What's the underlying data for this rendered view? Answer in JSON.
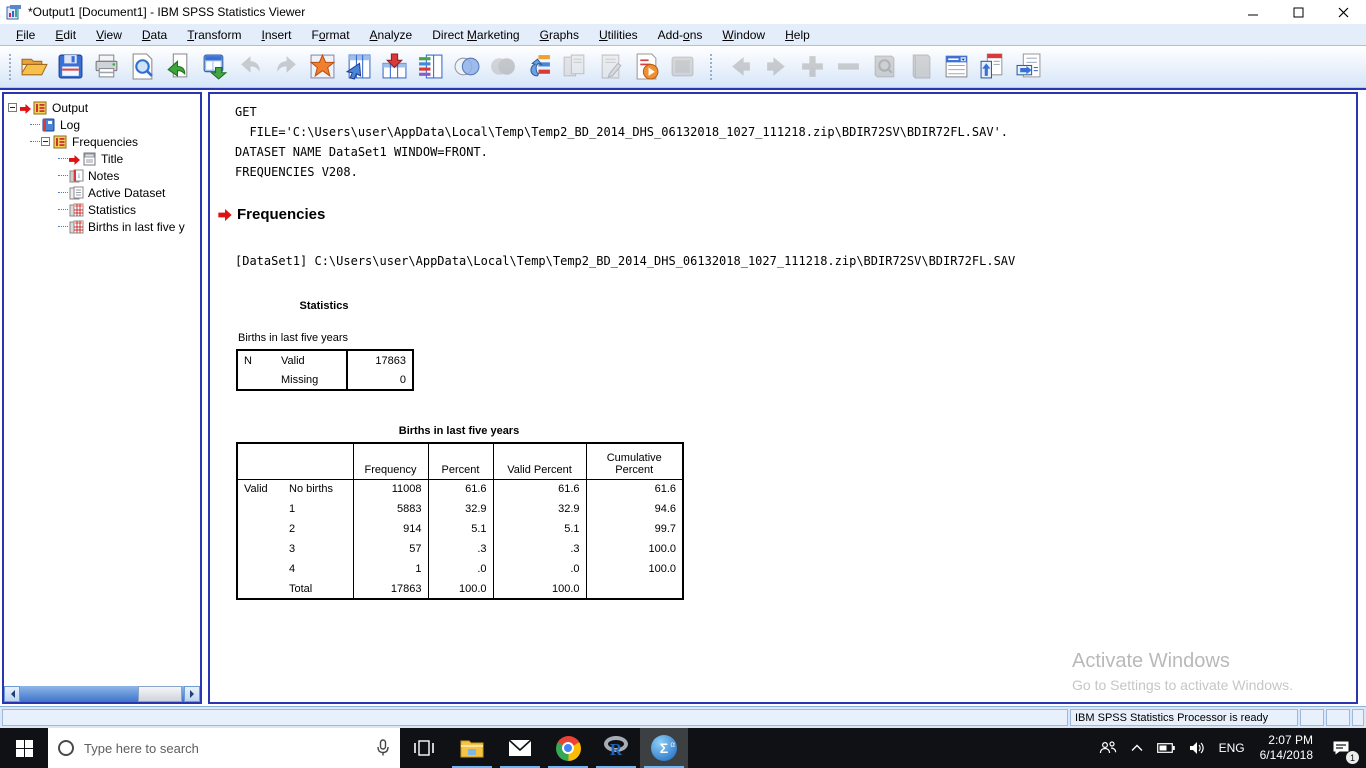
{
  "window": {
    "title": "*Output1 [Document1] - IBM SPSS Statistics Viewer"
  },
  "menu": {
    "items": [
      {
        "label": "File",
        "u": 0
      },
      {
        "label": "Edit",
        "u": 0
      },
      {
        "label": "View",
        "u": 0
      },
      {
        "label": "Data",
        "u": 0
      },
      {
        "label": "Transform",
        "u": 0
      },
      {
        "label": "Insert",
        "u": 0
      },
      {
        "label": "Format",
        "u": 1
      },
      {
        "label": "Analyze",
        "u": 0
      },
      {
        "label": "Direct Marketing",
        "u": 7
      },
      {
        "label": "Graphs",
        "u": 0
      },
      {
        "label": "Utilities",
        "u": 0
      },
      {
        "label": "Add-ons",
        "u": 4
      },
      {
        "label": "Window",
        "u": 0
      },
      {
        "label": "Help",
        "u": 0
      }
    ]
  },
  "toolbar": {
    "items": [
      {
        "name": "open-data-document",
        "glyph": "folder"
      },
      {
        "name": "save-document",
        "glyph": "floppy"
      },
      {
        "name": "print",
        "glyph": "printer"
      },
      {
        "name": "print-preview",
        "glyph": "doc-mag"
      },
      {
        "name": "recall-dialogs",
        "glyph": "doc-recall"
      },
      {
        "name": "export-output",
        "glyph": "export"
      },
      {
        "name": "undo",
        "glyph": "undo",
        "disabled": true
      },
      {
        "name": "redo",
        "glyph": "redo",
        "disabled": true
      },
      {
        "name": "goto-chart",
        "glyph": "star-grid"
      },
      {
        "name": "goto-data",
        "glyph": "grid-go"
      },
      {
        "name": "goto-case",
        "glyph": "grid-case"
      },
      {
        "name": "variables",
        "glyph": "grid-vars"
      },
      {
        "name": "use-variable-sets",
        "glyph": "venn"
      },
      {
        "name": "show-all-variables",
        "glyph": "venn-gray",
        "disabled": true
      },
      {
        "name": "select-last-output",
        "glyph": "tree-select"
      },
      {
        "name": "designate-window",
        "glyph": "docs-gray",
        "disabled": true
      },
      {
        "name": "edit-output",
        "glyph": "doc-edit",
        "disabled": true
      },
      {
        "name": "run-script",
        "glyph": "doc-play"
      },
      {
        "name": "activate-item",
        "glyph": "frame-gray",
        "disabled": true
      },
      {
        "sep": true
      },
      {
        "name": "promote-outline",
        "glyph": "arrow-left",
        "disabled": true
      },
      {
        "name": "demote-outline",
        "glyph": "arrow-right",
        "disabled": true
      },
      {
        "name": "expand-outline",
        "glyph": "plus",
        "disabled": true
      },
      {
        "name": "collapse-outline",
        "glyph": "minus",
        "disabled": true
      },
      {
        "name": "show-output",
        "glyph": "book-mag",
        "disabled": true
      },
      {
        "name": "hide-output",
        "glyph": "book",
        "disabled": true
      },
      {
        "name": "insert-heading",
        "glyph": "list-drop"
      },
      {
        "name": "insert-title",
        "glyph": "doc-up"
      },
      {
        "name": "insert-text",
        "glyph": "doc-right"
      }
    ]
  },
  "sidebar": {
    "tree": [
      {
        "label": "Output",
        "icon": "booklet",
        "lvl": 0,
        "expander": true,
        "arrow": true
      },
      {
        "label": "Log",
        "icon": "log",
        "lvl": 1
      },
      {
        "label": "Frequencies",
        "icon": "booklet",
        "lvl": 1,
        "expander": true
      },
      {
        "label": "Title",
        "icon": "title",
        "lvl": 2,
        "arrow": true
      },
      {
        "label": "Notes",
        "icon": "notes",
        "lvl": 2
      },
      {
        "label": "Active Dataset",
        "icon": "dataset",
        "lvl": 2
      },
      {
        "label": "Statistics",
        "icon": "table",
        "lvl": 2
      },
      {
        "label": "Births in last five y",
        "icon": "table",
        "lvl": 2
      }
    ]
  },
  "output": {
    "log_lines": [
      "GET",
      "  FILE='C:\\Users\\user\\AppData\\Local\\Temp\\Temp2_BD_2014_DHS_06132018_1027_111218.zip\\BDIR72SV\\BDIR72FL.SAV'.",
      "DATASET NAME DataSet1 WINDOW=FRONT.",
      "FREQUENCIES V208."
    ],
    "heading": "Frequencies",
    "dataset_line": "[DataSet1] C:\\Users\\user\\AppData\\Local\\Temp\\Temp2_BD_2014_DHS_06132018_1027_111218.zip\\BDIR72SV\\BDIR72FL.SAV",
    "stats_table": {
      "title": "Statistics",
      "subtitle": "Births in last five years",
      "rows": [
        [
          "N",
          "Valid",
          "17863"
        ],
        [
          "",
          "Missing",
          "0"
        ]
      ]
    },
    "freq_table": {
      "title": "Births in last five years",
      "columns": [
        "",
        "",
        "Frequency",
        "Percent",
        "Valid Percent",
        "Cumulative Percent"
      ],
      "rows": [
        [
          "Valid",
          "No births",
          "11008",
          "61.6",
          "61.6",
          "61.6"
        ],
        [
          "",
          "1",
          "5883",
          "32.9",
          "32.9",
          "94.6"
        ],
        [
          "",
          "2",
          "914",
          "5.1",
          "5.1",
          "99.7"
        ],
        [
          "",
          "3",
          "57",
          ".3",
          ".3",
          "100.0"
        ],
        [
          "",
          "4",
          "1",
          ".0",
          ".0",
          "100.0"
        ],
        [
          "",
          "Total",
          "17863",
          "100.0",
          "100.0",
          ""
        ]
      ]
    }
  },
  "watermark": {
    "line1": "Activate Windows",
    "line2": "Go to Settings to activate Windows."
  },
  "statusbar": {
    "message": "IBM SPSS Statistics Processor is ready"
  },
  "taskbar": {
    "search_placeholder": "Type here to search",
    "apps": [
      {
        "name": "file-explorer",
        "glyph": "explorer"
      },
      {
        "name": "mail",
        "glyph": "mail"
      },
      {
        "name": "chrome",
        "glyph": "chrome"
      },
      {
        "name": "r-studio",
        "glyph": "rlogo"
      },
      {
        "name": "spss",
        "glyph": "spss",
        "active": true
      }
    ],
    "tray": {
      "lang": "ENG",
      "time": "2:07 PM",
      "date": "6/14/2018",
      "badge": "1"
    }
  },
  "colors": {
    "pane_border": "#2a36b1",
    "menubar_bg": "#e4eefb",
    "taskbar_bg": "#101114",
    "underline": "#6cb8f6"
  }
}
